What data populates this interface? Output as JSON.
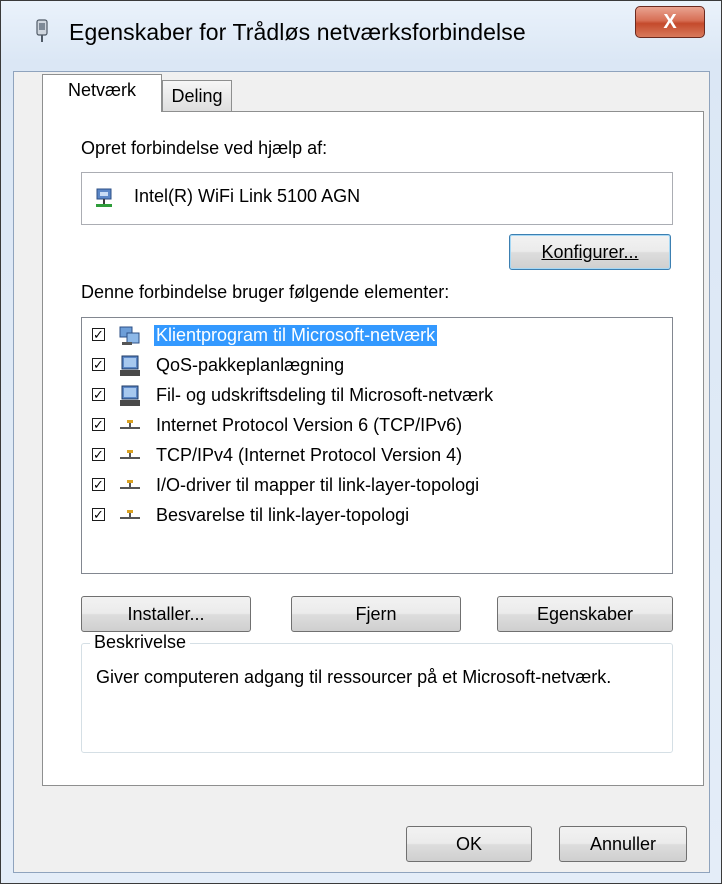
{
  "window": {
    "title": "Egenskaber for Trådløs netværksforbindelse",
    "close_label": "X"
  },
  "tabs": [
    {
      "label": "Netværk",
      "active": true
    },
    {
      "label": "Deling",
      "active": false
    }
  ],
  "connect_using": {
    "label": "Opret forbindelse ved hjælp af:",
    "adapter": "Intel(R) WiFi Link 5100 AGN",
    "adapter_icon": "network-adapter-icon",
    "configure_button": "Konfigurer..."
  },
  "items": {
    "label": "Denne forbindelse bruger følgende elementer:",
    "list": [
      {
        "label": "Klientprogram til Microsoft-netværk",
        "checked": true,
        "selected": true,
        "icon": "network-client-icon"
      },
      {
        "label": "QoS-pakkeplanlægning",
        "checked": true,
        "selected": false,
        "icon": "network-service-icon"
      },
      {
        "label": "Fil- og udskriftsdeling til Microsoft-netværk",
        "checked": true,
        "selected": false,
        "icon": "network-service-icon"
      },
      {
        "label": "Internet Protocol Version 6 (TCP/IPv6)",
        "checked": true,
        "selected": false,
        "icon": "protocol-icon"
      },
      {
        "label": "TCP/IPv4 (Internet Protocol Version 4)",
        "checked": true,
        "selected": false,
        "icon": "protocol-icon"
      },
      {
        "label": "I/O-driver til mapper til link-layer-topologi",
        "checked": true,
        "selected": false,
        "icon": "protocol-icon"
      },
      {
        "label": "Besvarelse til link-layer-topologi",
        "checked": true,
        "selected": false,
        "icon": "protocol-icon"
      }
    ]
  },
  "buttons": {
    "install": "Installer...",
    "remove": "Fjern",
    "properties": "Egenskaber",
    "ok": "OK",
    "cancel": "Annuller"
  },
  "description": {
    "legend": "Beskrivelse",
    "text": "Giver computeren adgang til ressourcer på et Microsoft-netværk."
  },
  "colors": {
    "selection": "#3399ff",
    "close_button": "#c44a2c",
    "titlebar": "#dbe7f5"
  }
}
